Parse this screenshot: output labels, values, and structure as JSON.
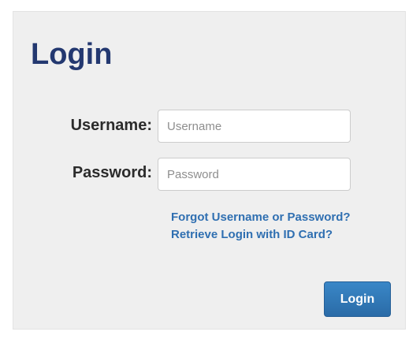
{
  "login_form": {
    "title": "Login",
    "username": {
      "label": "Username:",
      "value": "",
      "placeholder": "Username"
    },
    "password": {
      "label": "Password:",
      "value": "",
      "placeholder": "Password"
    },
    "links": {
      "forgot": "Forgot Username or Password?",
      "retrieve": "Retrieve Login with ID Card?"
    },
    "submit_label": "Login"
  },
  "colors": {
    "panel_background": "#efefef",
    "title": "#233870",
    "link": "#2f6fb1",
    "button": "#2a6ba7"
  }
}
